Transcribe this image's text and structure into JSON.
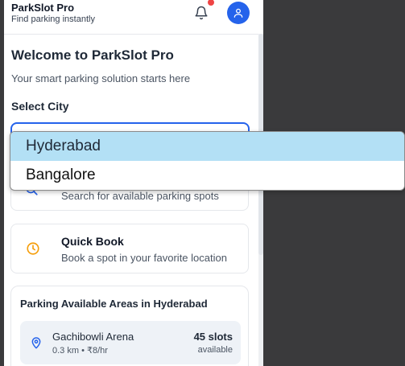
{
  "header": {
    "title": "ParkSlot Pro",
    "subtitle": "Find parking instantly",
    "notification_icon": "bell-icon",
    "avatar_icon": "user-icon",
    "accent_color": "#2563eb",
    "badge_color": "#ef4444"
  },
  "welcome": {
    "title": "Welcome to ParkSlot Pro",
    "subtitle": "Your smart parking solution starts here"
  },
  "city_select": {
    "label": "Select City",
    "selected": "Hyderabad",
    "options": [
      "Hyderabad",
      "Bangalore"
    ]
  },
  "actions": [
    {
      "icon": "search-icon",
      "title": "",
      "description": "Search for available parking spots"
    },
    {
      "icon": "clock-icon",
      "title": "Quick Book",
      "description": "Book a spot in your favorite location"
    }
  ],
  "areas": {
    "title": "Parking Available Areas in Hyderabad",
    "items": [
      {
        "name": "Gachibowli Arena",
        "meta": "0.3 km • ₹8/hr",
        "slots": "45 slots",
        "status": "available"
      }
    ]
  }
}
